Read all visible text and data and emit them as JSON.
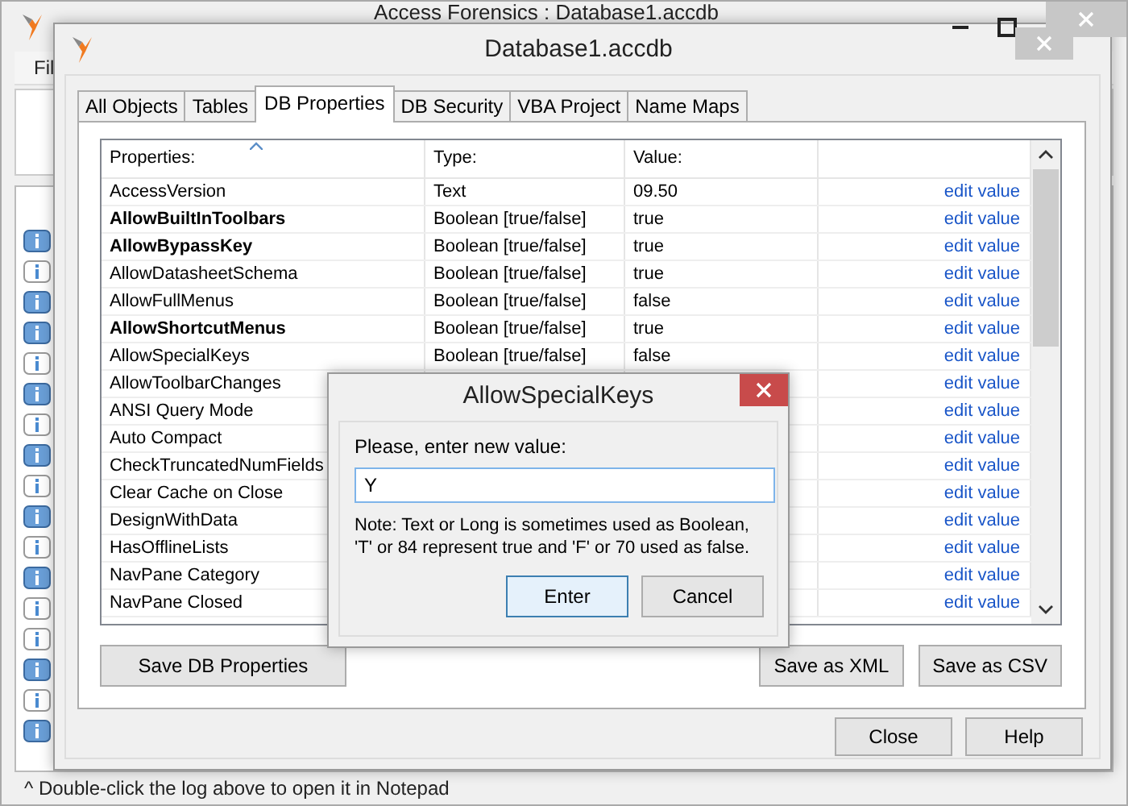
{
  "main_window": {
    "title": "Access Forensics : Database1.accdb",
    "menu": [
      "Fil"
    ],
    "log": [
      {
        "filled": true
      },
      {
        "filled": false
      },
      {
        "filled": true
      },
      {
        "filled": true
      },
      {
        "filled": false
      },
      {
        "filled": true
      },
      {
        "filled": false
      },
      {
        "filled": true
      },
      {
        "filled": false
      },
      {
        "filled": true
      },
      {
        "filled": false
      },
      {
        "filled": true
      },
      {
        "filled": false
      },
      {
        "filled": false
      },
      {
        "filled": true
      },
      {
        "filled": false
      },
      {
        "filled": true
      }
    ],
    "status_bar": "^ Double-click the log above to open it in Notepad"
  },
  "dialog": {
    "title": "Database1.accdb",
    "tabs": [
      {
        "label": "All Objects",
        "selected": false
      },
      {
        "label": "Tables",
        "selected": false
      },
      {
        "label": "DB Properties",
        "selected": true
      },
      {
        "label": "DB Security",
        "selected": false
      },
      {
        "label": "VBA Project",
        "selected": false
      },
      {
        "label": "Name Maps",
        "selected": false
      }
    ],
    "table": {
      "columns": [
        "Properties:",
        "Type:",
        "Value:"
      ],
      "rows": [
        {
          "name": "AccessVersion",
          "bold": false,
          "type": "Text",
          "value": "09.50",
          "action": "edit value"
        },
        {
          "name": "AllowBuiltInToolbars",
          "bold": true,
          "type": "Boolean [true/false]",
          "value": "true",
          "action": "edit value"
        },
        {
          "name": "AllowBypassKey",
          "bold": true,
          "type": "Boolean [true/false]",
          "value": "true",
          "action": "edit value"
        },
        {
          "name": "AllowDatasheetSchema",
          "bold": false,
          "type": "Boolean [true/false]",
          "value": "true",
          "action": "edit value"
        },
        {
          "name": "AllowFullMenus",
          "bold": false,
          "type": "Boolean [true/false]",
          "value": "false",
          "action": "edit value"
        },
        {
          "name": "AllowShortcutMenus",
          "bold": true,
          "type": "Boolean [true/false]",
          "value": "true",
          "action": "edit value"
        },
        {
          "name": "AllowSpecialKeys",
          "bold": false,
          "type": "Boolean [true/false]",
          "value": "false",
          "action": "edit value"
        },
        {
          "name": "AllowToolbarChanges",
          "bold": false,
          "action": "edit value"
        },
        {
          "name": "ANSI Query Mode",
          "bold": false,
          "action": "edit value"
        },
        {
          "name": "Auto Compact",
          "bold": false,
          "action": "edit value"
        },
        {
          "name": "CheckTruncatedNumFields",
          "bold": false,
          "action": "edit value"
        },
        {
          "name": "Clear Cache on Close",
          "bold": false,
          "action": "edit value"
        },
        {
          "name": "DesignWithData",
          "bold": false,
          "action": "edit value"
        },
        {
          "name": "HasOfflineLists",
          "bold": false,
          "action": "edit value"
        },
        {
          "name": "NavPane Category",
          "bold": false,
          "action": "edit value"
        },
        {
          "name": "NavPane Closed",
          "bold": false,
          "action": "edit value"
        }
      ]
    },
    "panel_buttons": [
      "Save DB Properties",
      "Save as XML",
      "Save as CSV"
    ],
    "footer_buttons": [
      "Close",
      "Help"
    ]
  },
  "prompt": {
    "title": "AllowSpecialKeys",
    "label": "Please, enter new value:",
    "value": "Y",
    "note": "Note: Text or Long is sometimes used as Boolean, 'T' or 84 represent true and 'F' or 70 used as false.",
    "buttons": [
      {
        "label": "Enter",
        "default": true
      },
      {
        "label": "Cancel",
        "default": false
      }
    ]
  }
}
